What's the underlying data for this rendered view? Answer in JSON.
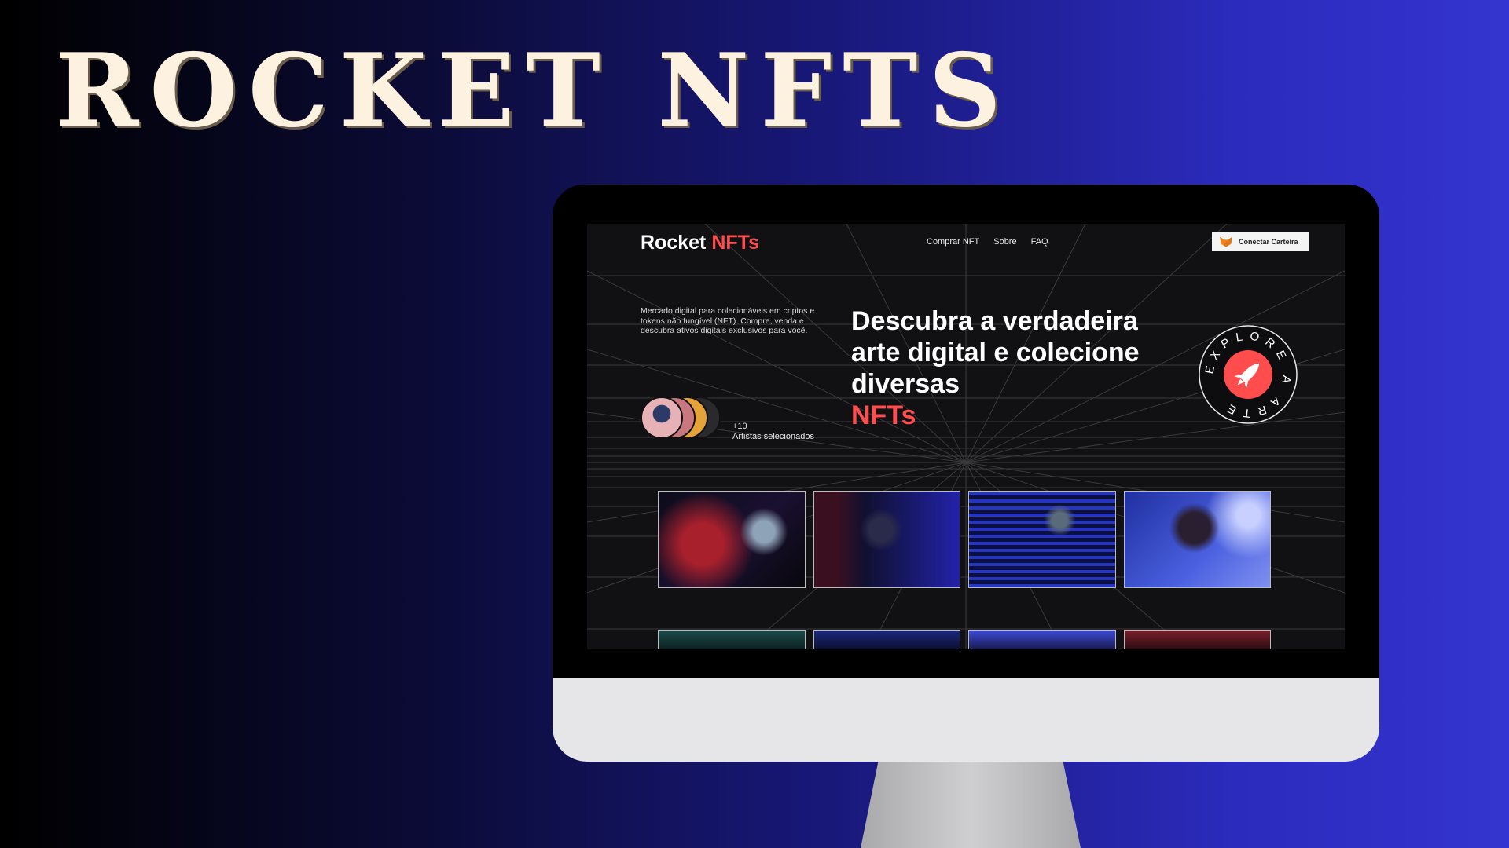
{
  "poster": {
    "title": "ROCKET NFTS"
  },
  "site": {
    "brand": {
      "name": "Rocket",
      "accent": "NFTs"
    },
    "nav": {
      "items": [
        "Comprar NFT",
        "Sobre",
        "FAQ"
      ]
    },
    "wallet_button": {
      "label": "Conectar Carteira",
      "icon": "metamask-fox-icon"
    },
    "hero": {
      "description": "Mercado digital para colecionáveis em criptos e tokens não fungível (NFT). Compre, venda e descubra ativos digitais exclusivos para você.",
      "heading": "Descubra a verdadeira arte digital e colecione diversas",
      "heading_accent": "NFTs",
      "artists_count": "+10",
      "artists_label": "Artistas selecionados",
      "badge_text": "EXPLORE A ARTE"
    },
    "colors": {
      "accent": "#ff4d4d",
      "background": "#111113"
    }
  }
}
